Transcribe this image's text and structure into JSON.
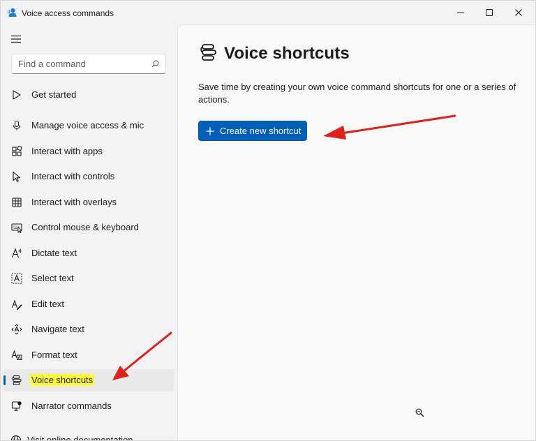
{
  "window": {
    "title": "Voice access commands",
    "icons": {
      "app": "voice-access-app-icon",
      "minimize": "minimize-icon",
      "maximize": "maximize-icon",
      "close": "close-icon"
    }
  },
  "sidebar": {
    "menu_icon": "hamburger-menu-icon",
    "search": {
      "placeholder": "Find a command",
      "value": "",
      "icon": "search-icon"
    },
    "items": [
      {
        "label": "Get started",
        "icon": "play-triangle-icon",
        "active": false
      },
      {
        "label": "Manage voice access & mic",
        "icon": "microphone-icon",
        "active": false
      },
      {
        "label": "Interact with apps",
        "icon": "apps-grid-icon",
        "active": false
      },
      {
        "label": "Interact with controls",
        "icon": "pointer-arrow-icon",
        "active": false
      },
      {
        "label": "Interact with overlays",
        "icon": "grid-overlay-icon",
        "active": false
      },
      {
        "label": "Control mouse & keyboard",
        "icon": "keyboard-mouse-icon",
        "active": false
      },
      {
        "label": "Dictate text",
        "icon": "dictate-text-icon",
        "active": false
      },
      {
        "label": "Select text",
        "icon": "select-text-icon",
        "active": false
      },
      {
        "label": "Edit text",
        "icon": "edit-text-icon",
        "active": false
      },
      {
        "label": "Navigate text",
        "icon": "navigate-text-icon",
        "active": false
      },
      {
        "label": "Format text",
        "icon": "format-text-icon",
        "active": false
      },
      {
        "label": "Voice shortcuts",
        "icon": "voice-shortcuts-icon",
        "active": true
      },
      {
        "label": "Narrator commands",
        "icon": "narrator-icon",
        "active": false
      },
      {
        "label": "Visit online documentation",
        "icon": "globe-icon",
        "active": false
      }
    ]
  },
  "main": {
    "title": "Voice shortcuts",
    "title_icon": "voice-shortcuts-icon",
    "description": "Save time by creating your own voice command shortcuts for one or a series of actions.",
    "create_button": {
      "label": "Create new shortcut",
      "icon": "plus-icon"
    }
  },
  "colors": {
    "accent": "#005fb8",
    "highlight": "#ffff33",
    "annotation_arrow": "#e0201a",
    "sidebar_bg": "#f3f3f3",
    "content_bg": "#f9f9f9"
  }
}
